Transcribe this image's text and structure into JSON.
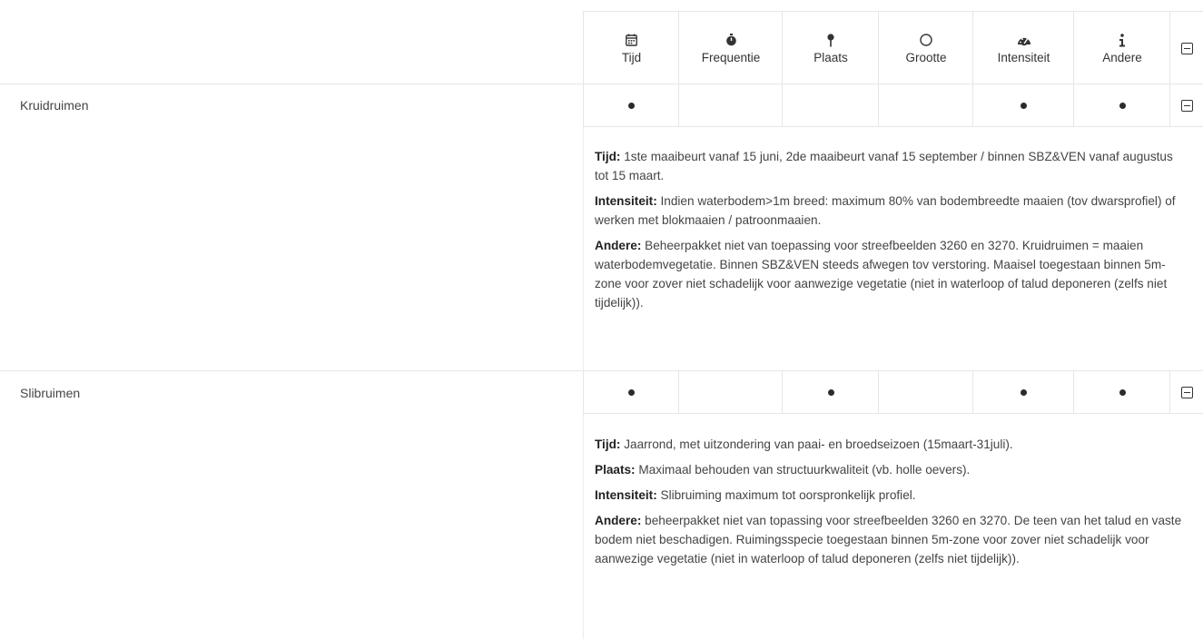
{
  "columns": [
    {
      "key": "tijd",
      "label": "Tijd",
      "icon": "calendar-icon",
      "glyph": "📅"
    },
    {
      "key": "frequentie",
      "label": "Frequentie",
      "icon": "stopwatch-icon",
      "glyph": "⏱"
    },
    {
      "key": "plaats",
      "label": "Plaats",
      "icon": "pin-icon",
      "glyph": "📍"
    },
    {
      "key": "grootte",
      "label": "Grootte",
      "icon": "circle-icon",
      "glyph": "○"
    },
    {
      "key": "intensiteit",
      "label": "Intensiteit",
      "icon": "gauge-icon",
      "glyph": "◕"
    },
    {
      "key": "andere",
      "label": "Andere",
      "icon": "info-icon",
      "glyph": "i"
    }
  ],
  "rows": [
    {
      "label": "Kruidruimen",
      "marks": [
        true,
        false,
        false,
        false,
        true,
        true
      ],
      "details": [
        {
          "term": "Tijd:",
          "text": " 1ste maaibeurt vanaf 15 juni, 2de maaibeurt vanaf 15 september / binnen SBZ&VEN vanaf augustus tot 15 maart."
        },
        {
          "term": "Intensiteit:",
          "text": " Indien waterbodem>1m breed: maximum 80% van bodembreedte maaien (tov dwarsprofiel) of werken met blokmaaien / patroonmaaien."
        },
        {
          "term": "Andere:",
          "text": " Beheerpakket niet van toepassing voor streefbeelden 3260 en 3270. Kruidruimen = maaien waterbodemvegetatie. Binnen SBZ&VEN steeds afwegen tov verstoring. Maaisel toegestaan binnen 5m-zone voor zover niet schadelijk voor aanwezige vegetatie (niet in waterloop of talud deponeren (zelfs niet tijdelijk))."
        }
      ]
    },
    {
      "label": "Slibruimen",
      "marks": [
        true,
        false,
        true,
        false,
        true,
        true
      ],
      "details": [
        {
          "term": "Tijd:",
          "text": " Jaarrond, met uitzondering van paai- en broedseizoen (15maart-31juli)."
        },
        {
          "term": "Plaats:",
          "text": " Maximaal behouden van structuurkwaliteit (vb. holle oevers)."
        },
        {
          "term": "Intensiteit:",
          "text": " Slibruiming maximum tot oorspronkelijk profiel."
        },
        {
          "term": "Andere:",
          "text": " beheerpakket niet van topassing voor streefbeelden 3260 en 3270. De teen van het talud en vaste bodem niet beschadigen. Ruimingsspecie toegestaan binnen 5m-zone voor zover niet schadelijk voor aanwezige vegetatie (niet in waterloop of talud deponeren (zelfs niet tijdelijk))."
        }
      ]
    }
  ]
}
